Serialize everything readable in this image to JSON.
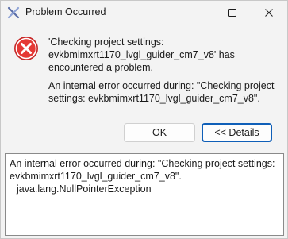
{
  "window": {
    "title": "Problem Occurred",
    "icons": {
      "app": "eclipse-x-icon",
      "minimize": "minimize-icon",
      "maximize": "maximize-icon",
      "close": "close-icon"
    }
  },
  "dialog": {
    "icon": "error-icon",
    "icon_color": "#d32f2f",
    "message_primary": "'Checking project settings: evkbmimxrt1170_lvgl_guider_cm7_v8' has encountered a problem.",
    "message_secondary": "An internal error occurred during: \"Checking project settings: evkbmimxrt1170_lvgl_guider_cm7_v8\"."
  },
  "buttons": {
    "ok_label": "OK",
    "details_label": "<< Details",
    "focus_color": "#0f5fb8"
  },
  "details": {
    "lines": [
      "An internal error occurred during: \"Checking project settings:",
      "evkbmimxrt1170_lvgl_guider_cm7_v8\".",
      "java.lang.NullPointerException"
    ]
  }
}
